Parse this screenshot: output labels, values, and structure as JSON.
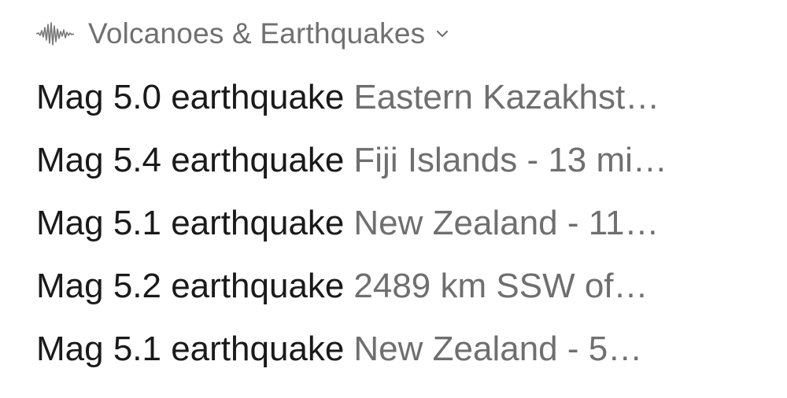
{
  "header": {
    "icon": "seismograph-wave-icon",
    "title": "Volcanoes & Earthquakes",
    "dropdown_icon": "chevron-down-icon"
  },
  "items": [
    {
      "title": "Mag 5.0 earthquake",
      "location": "Eastern Kazakhst…"
    },
    {
      "title": "Mag 5.4 earthquake",
      "location": "Fiji Islands - 13 mi…"
    },
    {
      "title": "Mag 5.1 earthquake",
      "location": "New Zealand - 11…"
    },
    {
      "title": "Mag 5.2 earthquake",
      "location": "2489 km SSW of…"
    },
    {
      "title": "Mag 5.1 earthquake",
      "location": "New Zealand - 5…"
    }
  ],
  "colors": {
    "title_text": "#1a1a1a",
    "secondary_text": "#6f6f6f",
    "background": "#ffffff"
  }
}
